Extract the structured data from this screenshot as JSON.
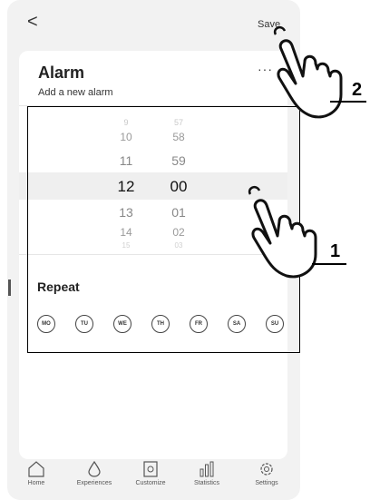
{
  "topbar": {
    "back_label": "<",
    "save_label": "Save"
  },
  "alarm": {
    "title": "Alarm",
    "subtitle": "Add a new alarm",
    "more_label": "···"
  },
  "picker": {
    "hours": [
      "9",
      "10",
      "11",
      "12",
      "13",
      "14",
      "15"
    ],
    "minutes": [
      "57",
      "58",
      "59",
      "00",
      "01",
      "02",
      "03"
    ],
    "selected_hour": "12",
    "selected_minute": "00"
  },
  "repeat": {
    "label": "Repeat",
    "days": [
      "MO",
      "TU",
      "WE",
      "TH",
      "FR",
      "SA",
      "SU"
    ]
  },
  "nav": {
    "items": [
      {
        "label": "Home",
        "icon": "home-icon"
      },
      {
        "label": "Experiences",
        "icon": "droplet-icon"
      },
      {
        "label": "Customize",
        "icon": "gear-box-icon"
      },
      {
        "label": "Statistics",
        "icon": "bar-chart-icon"
      },
      {
        "label": "Settings",
        "icon": "settings-icon"
      }
    ]
  },
  "callouts": {
    "label_1": "1",
    "label_2": "2"
  }
}
